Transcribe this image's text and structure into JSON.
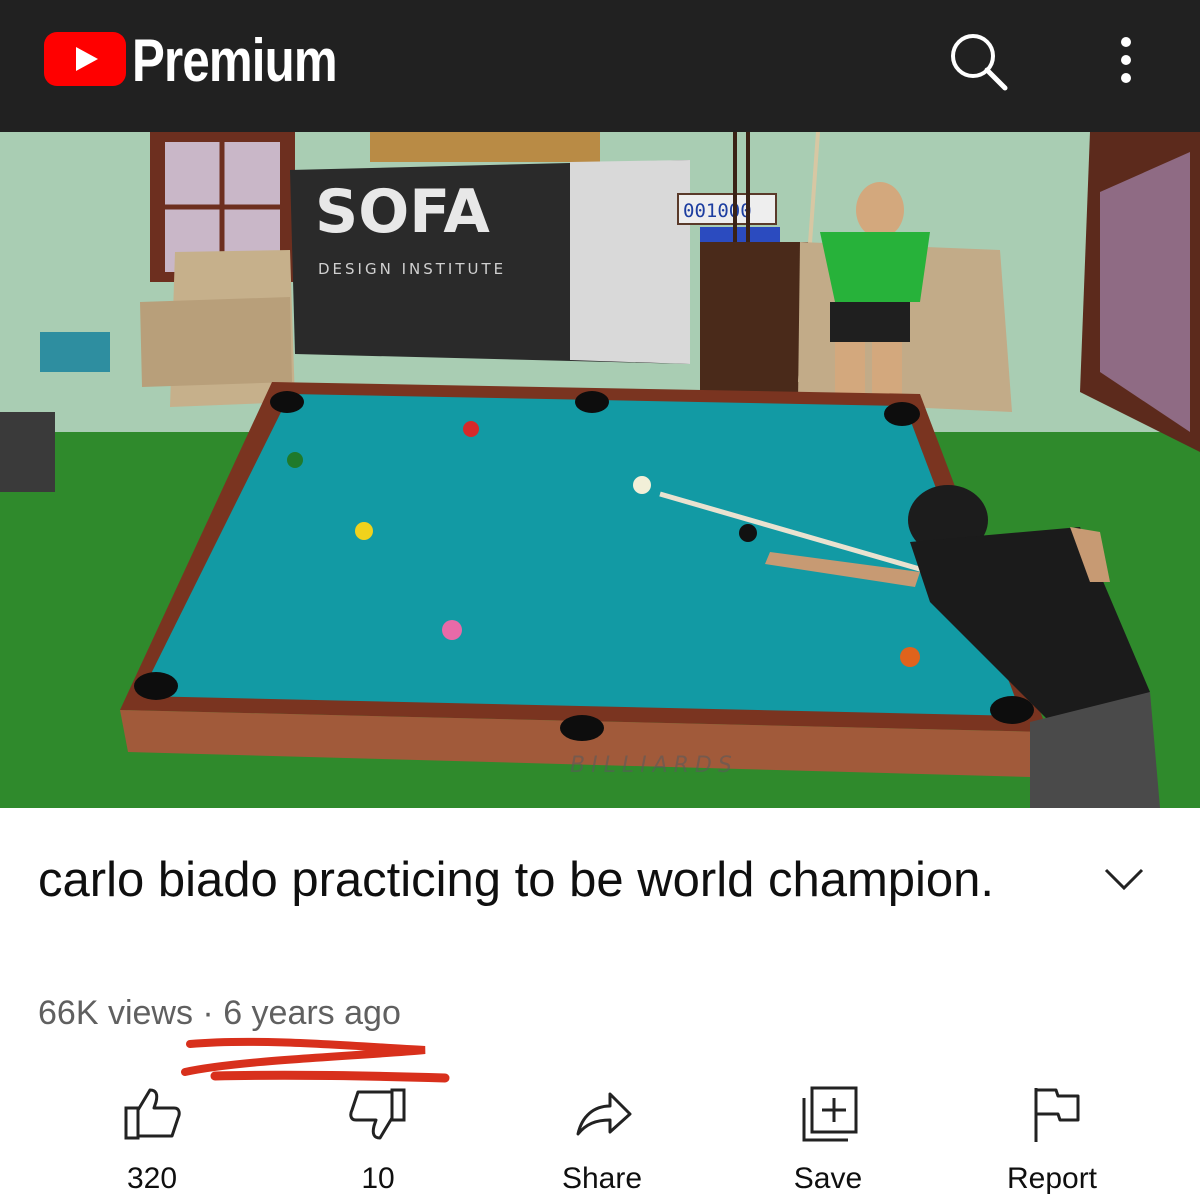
{
  "header": {
    "brand": "Premium",
    "logo_icon": "youtube-logo",
    "search_icon": "search-icon",
    "more_icon": "more-vertical-icon"
  },
  "video": {
    "banner_title": "SOFA",
    "banner_subtitle": "DESIGN INSTITUTE",
    "scoreboard": "001000",
    "table_brand": "BILLIARDS"
  },
  "info": {
    "title": "carlo biado practicing to be world champion.",
    "views": "66K views",
    "separator": " · ",
    "age": "6 years ago",
    "expand_icon": "chevron-down-icon"
  },
  "actions": [
    {
      "icon": "thumbs-up-icon",
      "label": "320"
    },
    {
      "icon": "thumbs-down-icon",
      "label": "10"
    },
    {
      "icon": "share-icon",
      "label": "Share"
    },
    {
      "icon": "save-to-playlist-icon",
      "label": "Save"
    },
    {
      "icon": "report-flag-icon",
      "label": "Report"
    }
  ],
  "colors": {
    "youtube_red": "#ff0000",
    "topbar": "#212121",
    "felt": "#129aa4",
    "annotation": "#d8301c"
  }
}
